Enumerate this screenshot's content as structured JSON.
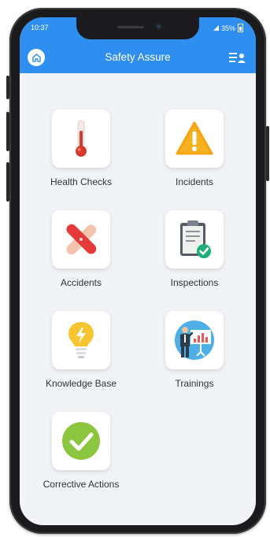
{
  "status_bar": {
    "time": "10:37",
    "battery": "35%"
  },
  "header": {
    "title": "Safety Assure"
  },
  "icons": {
    "home": "home-icon",
    "menu": "user-list-icon"
  },
  "colors": {
    "header": "#2e8ff0",
    "background": "#f1f3f6"
  },
  "tiles": [
    {
      "label": "Health Checks",
      "icon": "thermometer-icon"
    },
    {
      "label": "Incidents",
      "icon": "warning-icon"
    },
    {
      "label": "Accidents",
      "icon": "bandage-cross-icon"
    },
    {
      "label": "Inspections",
      "icon": "clipboard-check-icon"
    },
    {
      "label": "Knowledge Base",
      "icon": "lightbulb-icon"
    },
    {
      "label": "Trainings",
      "icon": "presentation-icon"
    },
    {
      "label": "Corrective Actions",
      "icon": "checkmark-circle-icon"
    }
  ]
}
